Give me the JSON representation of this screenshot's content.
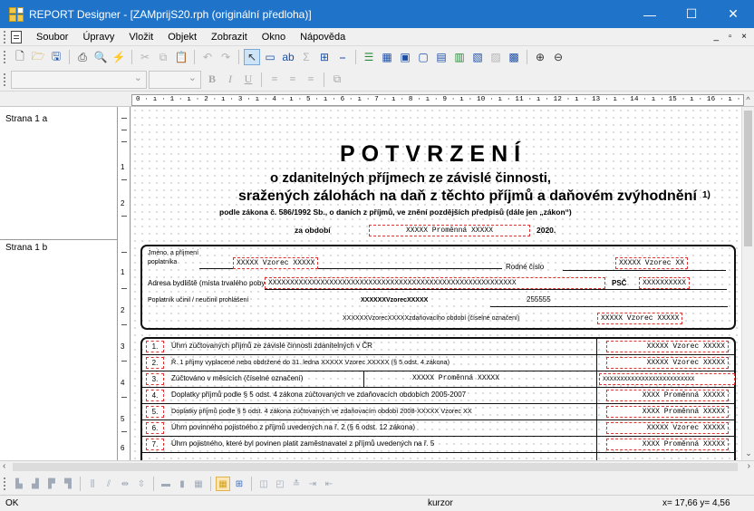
{
  "window": {
    "title": "REPORT Designer - [ZAMprijS20.rph (originální předloha)]",
    "minimize": "—",
    "maximize": "☐",
    "close": "✕"
  },
  "menu": {
    "items": [
      "Soubor",
      "Úpravy",
      "Vložit",
      "Objekt",
      "Zobrazit",
      "Okno",
      "Nápověda"
    ],
    "mdi_controls": "_ ▫ ×"
  },
  "ruler": {
    "text": "0 · ı · 1 · ı · 2 · ı · 3 · ı · 4 · ı · 5 · ı · 6 · ı · 7 · ı · 8 · ı · 9 · ı · 10 · ı · 11 · ı · 12 · ı · 13 · ı · 14 · ı · 15 · ı · 16 · ı · 17 · ı"
  },
  "bands": {
    "band_a": "Strana 1 a",
    "band_b": "Strana 1 b"
  },
  "vruler": {
    "labels_a": [
      "1",
      "2"
    ],
    "labels_b": [
      "1",
      "2",
      "3",
      "4",
      "5",
      "6"
    ]
  },
  "document": {
    "heading": "POTVRZENÍ",
    "subtitle1": "o zdanitelných příjmech ze závislé činnosti,",
    "subtitle2": "sražených zálohách na daň z těchto příjmů a daňovém zvýhodnění",
    "footnote_ref": "1)",
    "law_text": "podle zákona č. 586/1992 Sb., o daních z příjmů, ve znění pozdějších předpisů (dále jen „zákon“)",
    "period_label": "za období",
    "period_value": "XXXXX Proměnná XXXXX",
    "year": "2020.",
    "taxpayer": {
      "name_label_1": "Jméno, a příjmení",
      "name_label_2": "poplatníka",
      "name_value": "XXXXX Vzorec XXXXX",
      "rc_label": "Rodné číslo",
      "rc_value": "XXXXX Vzorec XX",
      "address_label": "Adresa bydliště (místa trvalého pobytu).",
      "address_value": "XXXXXXXXXXXXXXXXXXXXXXXXXXXXXXXXXXXXXXXXXXXXXXXXXXXXXXXXX",
      "psc_label": "PSČ",
      "psc_value": "XXXXXXXXXX",
      "declaration_label": "Poplatník učinil / neučinil prohlášení",
      "declaration_value": "XXXXXXVzorecXXXXX",
      "declaration_value_2": "255555",
      "declaration_period": "XXXXXXVzorecXXXXXzdaňovacího období (číselné označení)",
      "declaration_period_value": "XXXXX Vzorec XXXXX"
    },
    "rows": [
      {
        "num": "1.",
        "text": "Úhrn zúčtovaných příjmů ze závislé činnosti zdanitelných v ČR",
        "value": "XXXXX Vzorec XXXXX"
      },
      {
        "num": "2.",
        "text": "Ř. 1 příjmy vyplacené nebo obdržené do 31. ledna XXXXX Vzorec XXXXX (§ 5 odst. 4 zákona)",
        "value": "XXXXX Vzorec XXXXX"
      },
      {
        "num": "3.",
        "text": "Zúčtováno v měsících (číselné označení)",
        "mid_value": "XXXXX Proměnná XXXXX",
        "value": "XXXXXXXXXXXXXXXXXXXXXXXXXX"
      },
      {
        "num": "4.",
        "text": "Doplatky příjmů podle § 5 odst. 4 zákona zúčtovaných ve zdaňovacích obdobích 2005-2007",
        "value": "XXXX Proměnná XXXXX"
      },
      {
        "num": "5.",
        "text": "Doplatky příjmů podle § 5 odst. 4 zákona zúčtovaných ve zdaňovacím období 2008-XXXXX Vzorec XX",
        "value": "XXXX Proměnná XXXXX"
      },
      {
        "num": "6.",
        "text": "Úhrn povinného pojistného z příjmů uvedených na ř. 2 (§ 6 odst. 12 zákona)",
        "value": "XXXXX Vzorec XXXXX"
      },
      {
        "num": "7.",
        "text": "Úhrn pojistného, které byl povinen platit zaměstnavatel z příjmů uvedených na ř. 5",
        "value": "XXXX Proměnná XXXXX"
      }
    ]
  },
  "status": {
    "left": "OK",
    "mode": "kurzor",
    "coords": "x= 17,66  y= 4,56"
  }
}
